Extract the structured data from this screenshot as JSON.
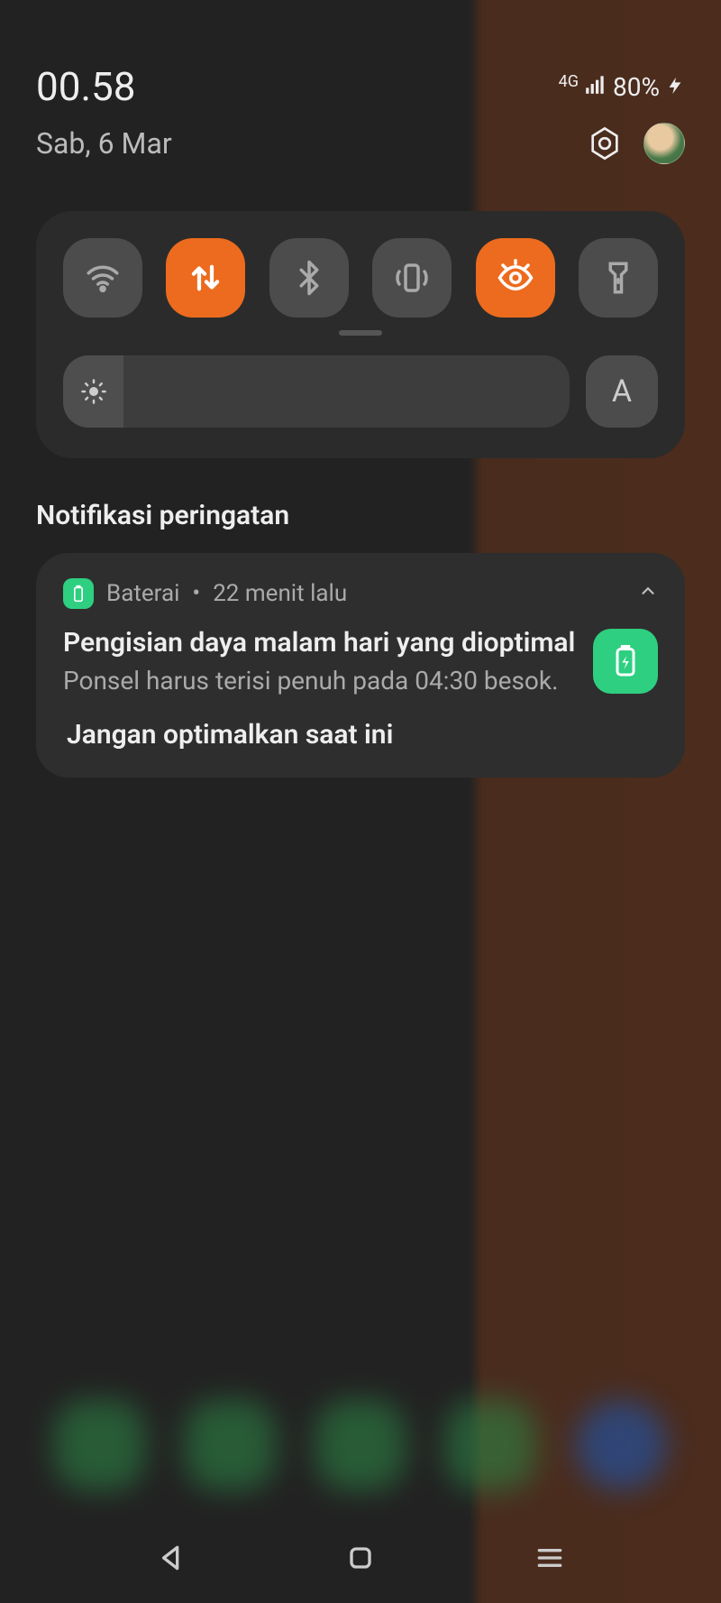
{
  "status": {
    "time": "00.58",
    "date": "Sab, 6 Mar",
    "network_label": "4G",
    "battery_text": "80%"
  },
  "quick_settings": {
    "tiles": [
      {
        "name": "wifi",
        "active": false
      },
      {
        "name": "mobile-data",
        "active": true
      },
      {
        "name": "bluetooth",
        "active": false
      },
      {
        "name": "vibrate",
        "active": false
      },
      {
        "name": "eye-comfort",
        "active": true
      },
      {
        "name": "flashlight",
        "active": false
      }
    ],
    "brightness_percent": 12,
    "auto_label": "A"
  },
  "section_title": "Notifikasi peringatan",
  "notification": {
    "app_name": "Baterai",
    "time_ago": "22 menit lalu",
    "title": "Pengisian daya malam hari yang dioptimal..",
    "message": "Ponsel harus terisi penuh pada 04:30 besok.",
    "action": "Jangan optimalkan saat ini"
  }
}
